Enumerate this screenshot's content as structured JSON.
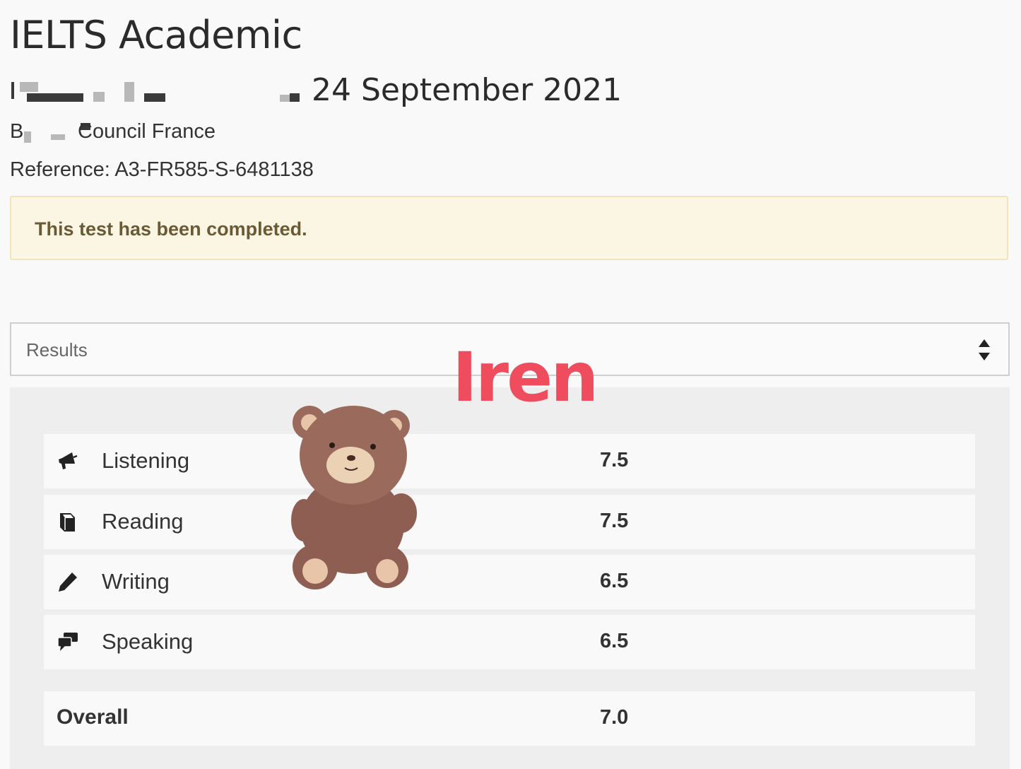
{
  "header": {
    "title": "IELTS Academic",
    "date": "24 September 2021",
    "centre_prefix": "B",
    "centre_suffix": "Council France",
    "reference": "Reference: A3-FR585-S-6481138"
  },
  "alert": {
    "message": "This test has been completed."
  },
  "results_select": {
    "selected": "Results"
  },
  "watermark": {
    "text": "Iren"
  },
  "results": {
    "rows": [
      {
        "label": "Listening",
        "score": "7.5",
        "icon": "megaphone-icon"
      },
      {
        "label": "Reading",
        "score": "7.5",
        "icon": "book-icon"
      },
      {
        "label": "Writing",
        "score": "6.5",
        "icon": "pencil-icon"
      },
      {
        "label": "Speaking",
        "score": "6.5",
        "icon": "speech-bubbles-icon"
      }
    ],
    "overall": {
      "label": "Overall",
      "score": "7.0"
    }
  },
  "colors": {
    "alert_background": "#fbf6e3",
    "alert_text": "#6b5a36",
    "watermark": "#ef4d5e"
  }
}
